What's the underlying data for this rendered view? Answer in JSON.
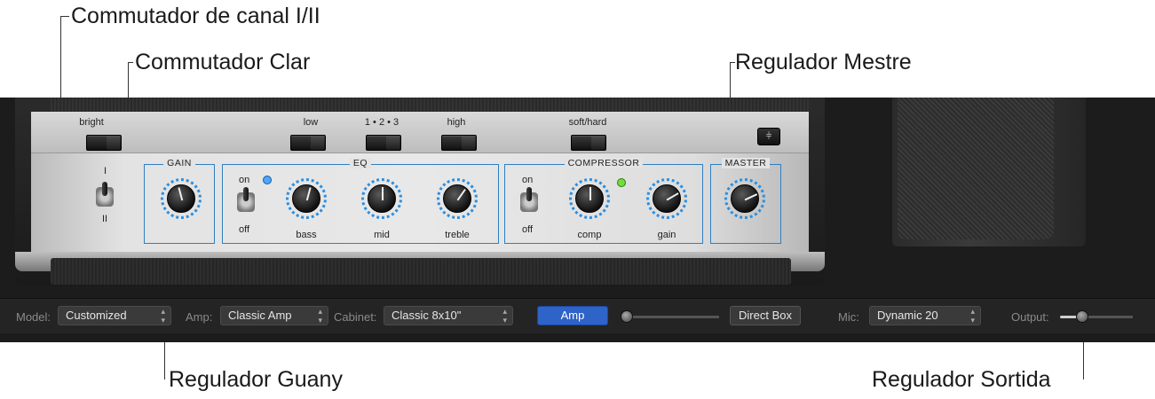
{
  "callouts": {
    "channel_switch": "Commutador de canal I/II",
    "bright_switch": "Commutador Clar",
    "master_knob": "Regulador Mestre",
    "gain_knob": "Regulador Guany",
    "output_slider": "Regulador Sortida"
  },
  "amp": {
    "switch_labels": {
      "bright": "bright",
      "low": "low",
      "mode": "1 • 2 • 3",
      "high": "high",
      "softhard": "soft/hard"
    },
    "settings_icon": "sliders-icon",
    "channel": {
      "one": "I",
      "two": "II"
    },
    "sections": {
      "gain": "GAIN",
      "eq": "EQ",
      "compressor": "COMPRESSOR",
      "master": "MASTER"
    },
    "eq": {
      "on": "on",
      "off": "off",
      "bass": "bass",
      "mid": "mid",
      "treble": "treble"
    },
    "compressor": {
      "on": "on",
      "off": "off",
      "comp": "comp",
      "gain": "gain"
    }
  },
  "bar": {
    "model_label": "Model:",
    "model_value": "Customized",
    "amp_label": "Amp:",
    "amp_value": "Classic Amp",
    "cabinet_label": "Cabinet:",
    "cabinet_value": "Classic 8x10\"",
    "amp_button": "Amp",
    "direct_box_button": "Direct Box",
    "mic_label": "Mic:",
    "mic_value": "Dynamic 20",
    "output_label": "Output:",
    "blend_level": 0.05,
    "output_level": 0.3
  },
  "colors": {
    "accent_blue": "#2b8fe0",
    "led_blue": "#4aa8ff",
    "led_green": "#6fe03a",
    "amp_button": "#2e63c8"
  }
}
